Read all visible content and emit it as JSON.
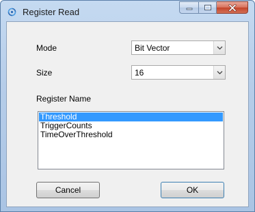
{
  "window": {
    "title": "Register Read"
  },
  "mode": {
    "label": "Mode",
    "value": "Bit Vector"
  },
  "size": {
    "label": "Size",
    "value": "16"
  },
  "register": {
    "label": "Register Name",
    "items": [
      "Threshold",
      "TriggerCounts",
      "TimeOverThreshold"
    ],
    "selected": "Threshold"
  },
  "buttons": {
    "cancel": "Cancel",
    "ok": "OK"
  }
}
